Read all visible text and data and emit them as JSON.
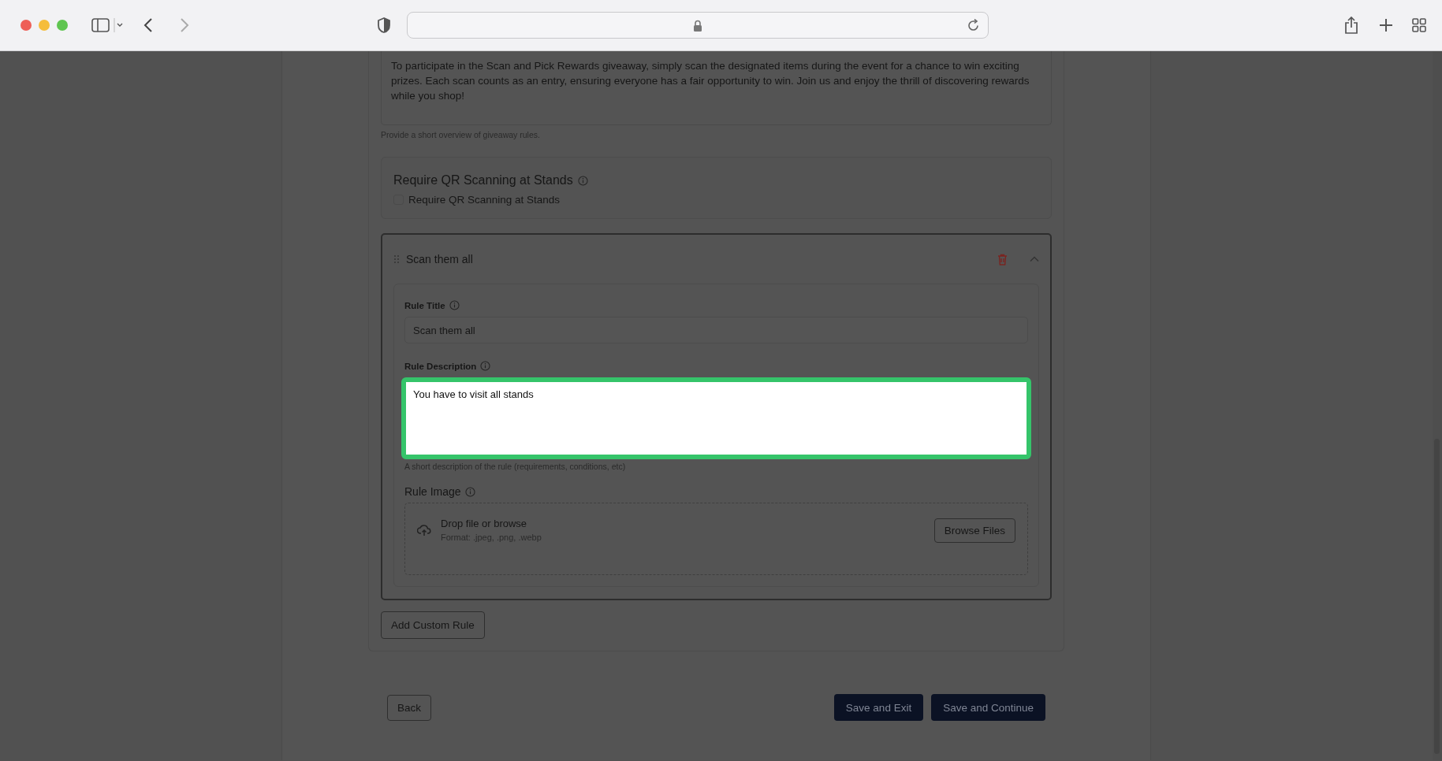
{
  "giveaway_description": {
    "value": "To participate in the Scan and Pick Rewards giveaway, simply scan the designated items during the event for a chance to win exciting prizes. Each scan counts as an entry, ensuring everyone has a fair opportunity to win. Join us and enjoy the thrill of discovering rewards while you shop!",
    "helper": "Provide a short overview of giveaway rules."
  },
  "qr_section": {
    "title": "Require QR Scanning at Stands",
    "checkbox": {
      "label": "Require QR Scanning at Stands",
      "checked": false
    }
  },
  "rule": {
    "title": "Scan them all",
    "expanded": true,
    "rule_title": {
      "label": "Rule Title",
      "value": "Scan them all"
    },
    "rule_description": {
      "label": "Rule Description",
      "value": "You have to visit all stands",
      "focused": true,
      "helper": "A short description of the rule (requirements, conditions, etc)"
    },
    "rule_image": {
      "label": "Rule Image",
      "drop_text": "Drop file or browse",
      "formats": "Format: .jpeg, .png, .webp",
      "button": "Browse Files"
    }
  },
  "add_rule_button": "Add Custom Rule",
  "footer_buttons": [
    {
      "label": "Back",
      "kind": "outline"
    },
    {
      "label": "Save and Exit",
      "kind": "primary"
    },
    {
      "label": "Save and Continue",
      "kind": "primary"
    }
  ]
}
